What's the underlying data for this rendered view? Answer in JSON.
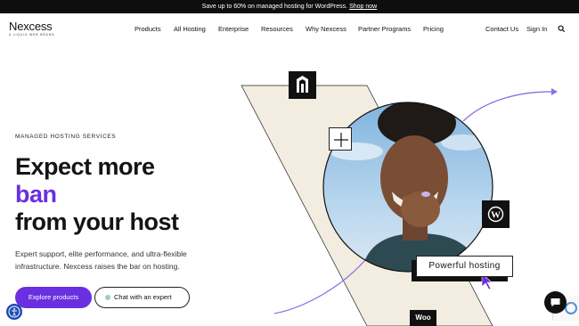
{
  "promo": {
    "text": "Save up to 60% on managed hosting for WordPress.",
    "link": "Shop now"
  },
  "brand": {
    "name": "Nexcess",
    "tagline": "A LIQUID WEB BRAND"
  },
  "nav": {
    "items": [
      "Products",
      "All Hosting",
      "Enterprise",
      "Resources",
      "Why Nexcess",
      "Partner Programs",
      "Pricing"
    ],
    "contact": "Contact Us",
    "signin": "Sign In"
  },
  "hero": {
    "eyebrow": "MANAGED HOSTING SERVICES",
    "line1": "Expect more",
    "line2": "ban",
    "line3": "from your host",
    "subtext": "Expert support, elite performance, and ultra-flexible infrastructure. Nexcess raises the bar on hosting.",
    "primary_cta": "Explore products",
    "secondary_cta": "Chat with an expert",
    "callout": "Powerful hosting",
    "woo_label": "Woo"
  },
  "colors": {
    "accent": "#6a2fe0",
    "cream": "#f3ece0",
    "dark": "#111111",
    "sky": "#a8cbe8",
    "arrow": "#8b6fe8"
  },
  "icons": [
    "magento-icon",
    "plus-icon",
    "wordpress-icon",
    "woocommerce-icon",
    "cursor-icon",
    "search-icon",
    "accessibility-icon",
    "chat-icon",
    "recaptcha-icon"
  ]
}
